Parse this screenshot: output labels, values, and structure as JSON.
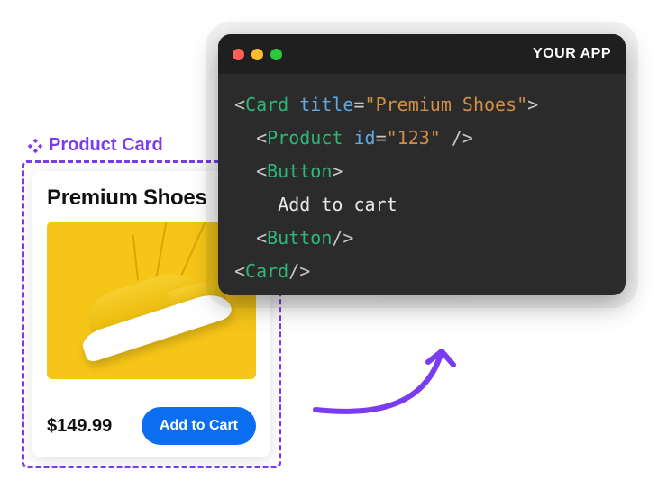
{
  "annotation": {
    "label": "Product Card"
  },
  "product": {
    "title": "Premium Shoes",
    "price": "$149.99",
    "cta_label": "Add to Cart",
    "image_alt": "yellow-sneaker"
  },
  "code_window": {
    "app_label": "YOUR APP",
    "lines": {
      "l1": {
        "open": "<",
        "tag": "Card",
        "attr": "title",
        "eq": "=",
        "val": "\"Premium Shoes\"",
        "close": ">"
      },
      "l2": {
        "indent": "  ",
        "open": "<",
        "tag": "Product",
        "attr": "id",
        "eq": "=",
        "val": "\"123\"",
        "close": " />"
      },
      "l3": {
        "indent": "  ",
        "open": "<",
        "tag": "Button",
        "close": ">"
      },
      "l4": {
        "indent": "    ",
        "text": "Add to cart"
      },
      "l5": {
        "indent": "  ",
        "open": "<",
        "tag": "Button",
        "close": "/>"
      },
      "l6": {
        "open": "<",
        "tag": "Card",
        "close": "/>"
      }
    }
  },
  "colors": {
    "accent": "#7a3cf0",
    "button": "#0b6ef0",
    "product_bg": "#f5c518"
  }
}
